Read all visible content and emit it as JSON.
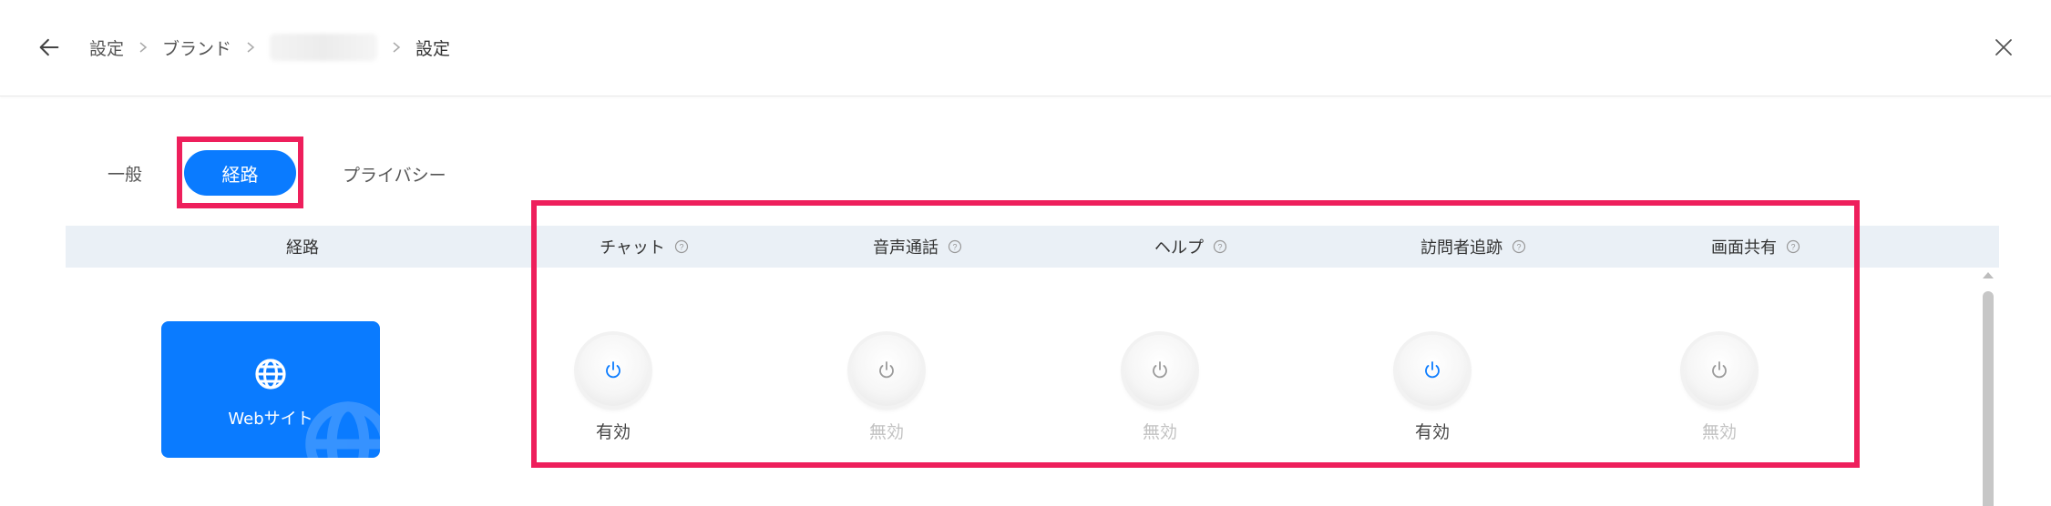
{
  "header": {
    "breadcrumb": [
      "設定",
      "ブランド",
      "設定"
    ]
  },
  "tabs": {
    "general": "一般",
    "route": "経路",
    "privacy": "プライバシー"
  },
  "table": {
    "columns": {
      "route": "経路",
      "chat": "チャット",
      "voice": "音声通話",
      "help": "ヘルプ",
      "visitor": "訪問者追跡",
      "screen": "画面共有"
    }
  },
  "channel": {
    "label": "Webサイト",
    "icon": "globe-icon"
  },
  "toggles": {
    "chat": {
      "state": true,
      "label": "有効"
    },
    "voice": {
      "state": false,
      "label": "無効"
    },
    "help": {
      "state": false,
      "label": "無効"
    },
    "visitor": {
      "state": true,
      "label": "有効"
    },
    "screen": {
      "state": false,
      "label": "無効"
    }
  },
  "colors": {
    "accent": "#0a7bff",
    "highlight": "#ee1f5c",
    "header_bg": "#eaf0f6",
    "disabled_text": "#c2c2c2"
  }
}
